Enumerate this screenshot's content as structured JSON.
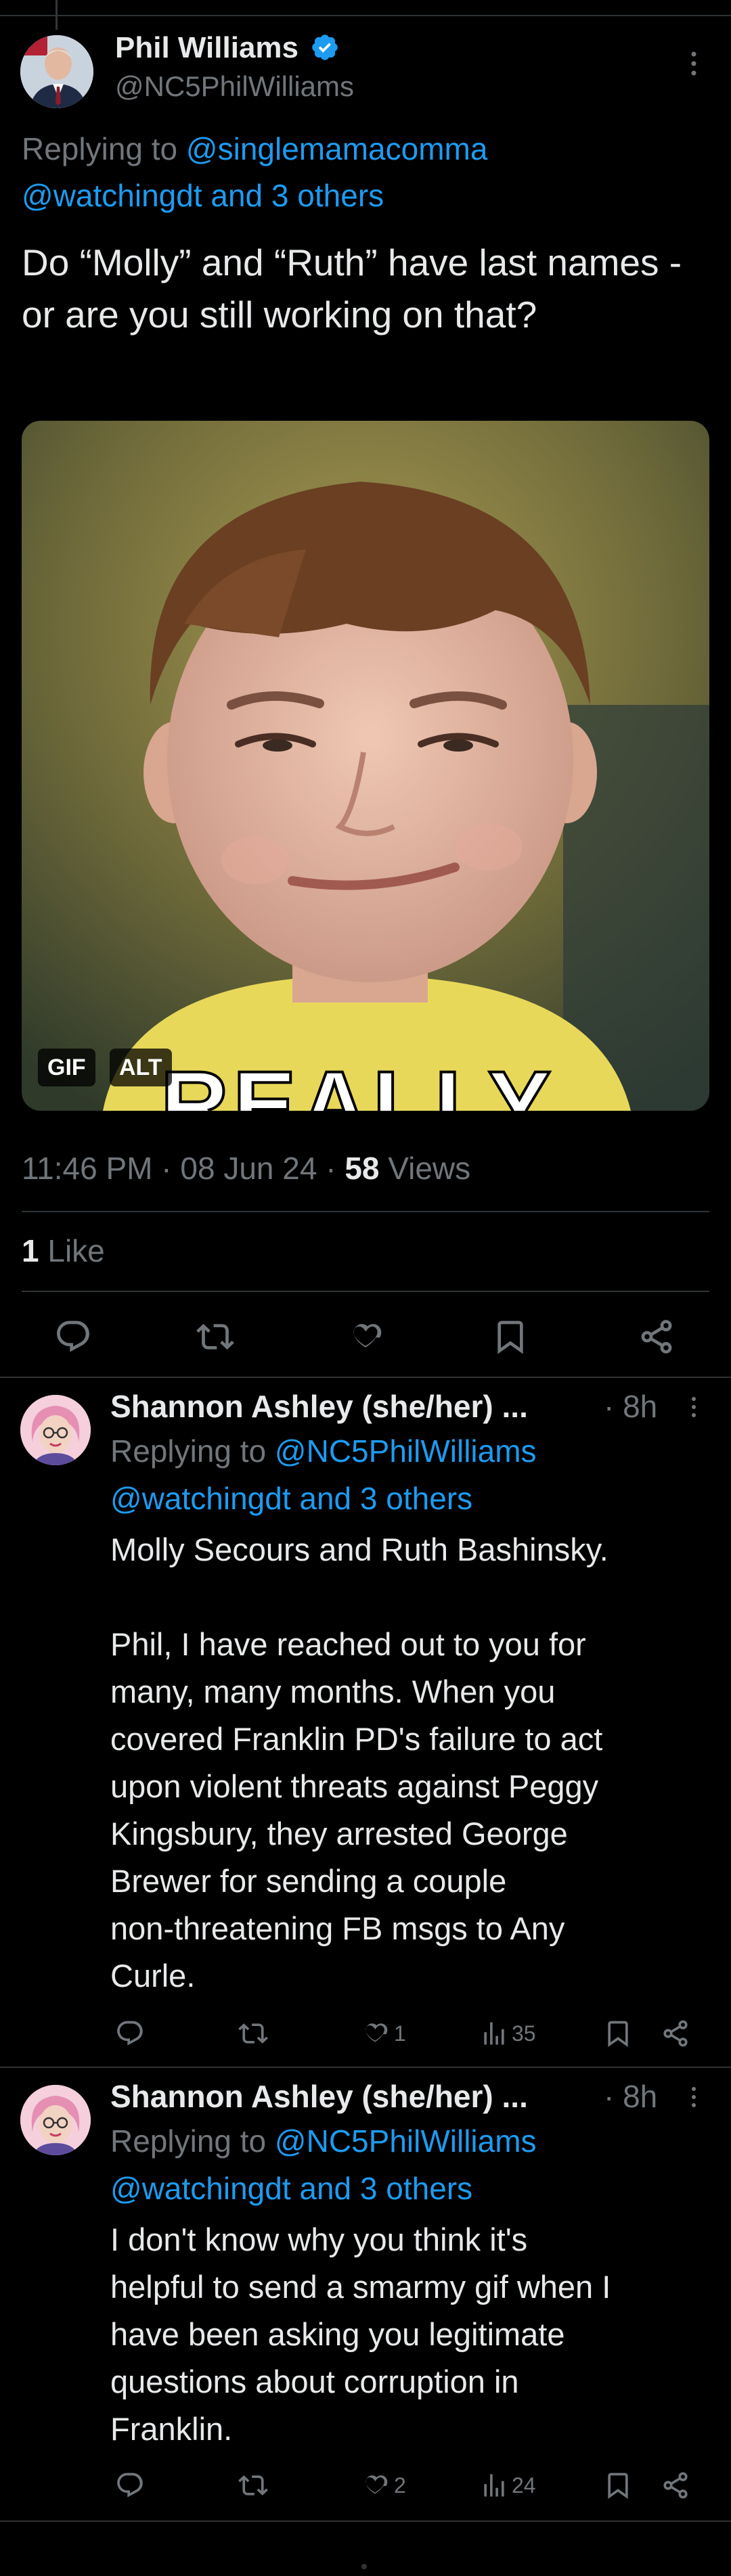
{
  "main_tweet": {
    "author_name": "Phil Williams",
    "handle": "@NC5PhilWilliams",
    "replying_label": "Replying to",
    "replying_user": "@singlemamacomma",
    "replying_more": "@watchingdt and 3 others",
    "text": "Do “Molly” and “Ruth” have last names - or are you still working on that?",
    "gif_overlay_text": "REALLY",
    "gif_badge": "GIF",
    "alt_badge": "ALT",
    "time": "11:46 PM",
    "date": "08 Jun 24",
    "views_count": "58",
    "views_label": "Views",
    "likes_count": "1",
    "likes_label": "Like"
  },
  "replies": [
    {
      "author_name": "Shannon Ashley (she/her) ...",
      "time_ago": "· 8h",
      "replying_label": "Replying to",
      "replying_user": "@NC5PhilWilliams",
      "replying_more": "@watchingdt and 3 others",
      "text_lines": [
        "Molly Secours and Ruth Bashinsky.",
        "",
        "Phil, I have reached out to you for",
        "many, many months. When you",
        "covered Franklin PD's failure to act",
        "upon violent threats against Peggy",
        "Kingsbury, they arrested George",
        "Brewer for sending a couple",
        "non-threatening FB msgs to Any",
        "Curle."
      ],
      "likes": "1",
      "views": "35"
    },
    {
      "author_name": "Shannon Ashley (she/her) ...",
      "time_ago": "· 8h",
      "replying_label": "Replying to",
      "replying_user": "@NC5PhilWilliams",
      "replying_more": "@watchingdt and 3 others",
      "text_lines": [
        "I don't know why you think it's",
        "helpful to send a smarmy gif when I",
        "have been asking you legitimate",
        "questions about corruption in",
        "Franklin."
      ],
      "likes": "2",
      "views": "24"
    }
  ],
  "colors": {
    "background": "#000000",
    "text": "#e7e9ea",
    "secondary": "#71767b",
    "link": "#1d9bf0",
    "verified": "#1d9bf0",
    "divider": "#2f3336"
  },
  "icons": [
    "verified-badge-icon",
    "more-icon",
    "reply-icon",
    "retweet-icon",
    "like-icon",
    "views-icon",
    "bookmark-icon",
    "share-icon"
  ]
}
